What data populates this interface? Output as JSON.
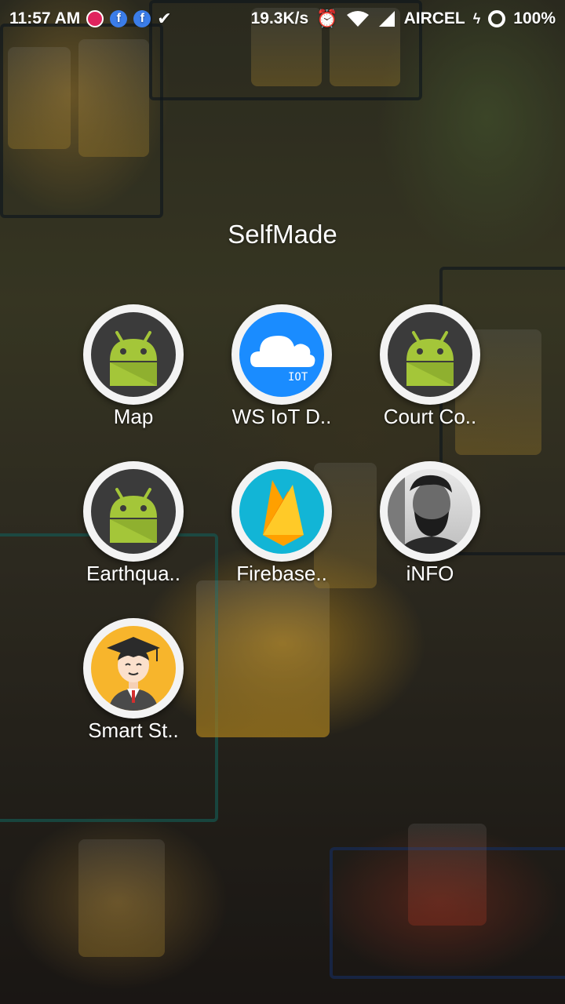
{
  "status_bar": {
    "time": "11:57 AM",
    "net_speed": "19.3K/s",
    "carrier": "AIRCEL",
    "battery": "100%"
  },
  "folder": {
    "title": "SelfMade",
    "apps": [
      {
        "label": "Map",
        "icon": "android-icon"
      },
      {
        "label": "WS IoT D..",
        "icon": "iot-cloud-icon"
      },
      {
        "label": "Court Co..",
        "icon": "android-icon"
      },
      {
        "label": "Earthqua..",
        "icon": "android-icon"
      },
      {
        "label": "Firebase..",
        "icon": "firebase-icon"
      },
      {
        "label": "iNFO",
        "icon": "profile-photo-icon"
      },
      {
        "label": "Smart St..",
        "icon": "graduate-icon"
      }
    ]
  },
  "colors": {
    "android_green": "#a4c639",
    "iot_blue": "#1a8cff",
    "firebase_bg": "#12b5d6",
    "graduate_bg": "#f7b52c"
  }
}
